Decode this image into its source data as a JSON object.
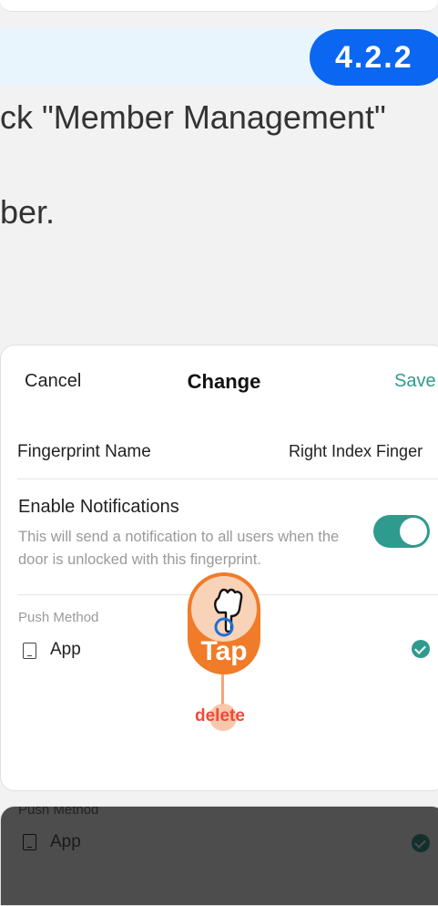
{
  "step_badge": "4.2.2",
  "instruction": {
    "line1": "ck \"Member Management\"",
    "line2": "ber."
  },
  "sheet": {
    "cancel_label": "Cancel",
    "title": "Change",
    "save_label": "Save",
    "fingerprint_name_label": "Fingerprint Name",
    "fingerprint_name_value": "Right Index Finger",
    "notifications_label": "Enable Notifications",
    "notifications_description": "This will send a notification to all users when the door is unlocked with this fingerprint.",
    "notifications_enabled": true,
    "push_method_label": "Push Method",
    "push_option_label": "App",
    "push_option_selected": true
  },
  "overlay": {
    "tap_label": "Tap",
    "target_label": "delete"
  },
  "background_sheet": {
    "push_method_label": "Push Method",
    "push_option_label": "App"
  },
  "colors": {
    "accent": "#2f9b8f",
    "badge": "#0b66f2",
    "tap": "#f07b28",
    "delete": "#ef4a3b"
  },
  "icons": [
    "hand-pointer-icon",
    "phone-icon",
    "check-circle-icon"
  ]
}
